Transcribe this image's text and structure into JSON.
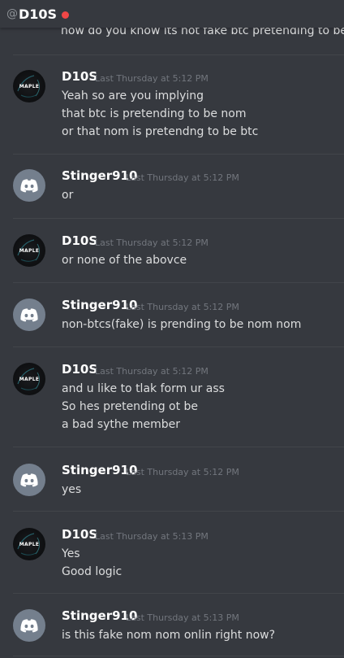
{
  "header": {
    "at_symbol": "@",
    "title": "D10S",
    "status_color": "#f04747"
  },
  "clipped_previous_line": "how do you know its not fake btc pretending to be nom n",
  "messages": [
    {
      "username": "D10S",
      "timestamp": "Last Thursday at 5:12 PM",
      "avatar": "maple",
      "lines": [
        "Yeah so are you implying",
        "that btc is pretending to be nom",
        "or that nom is pretendng to be btc"
      ]
    },
    {
      "username": "Stinger910",
      "timestamp": "Last Thursday at 5:12 PM",
      "avatar": "discord",
      "lines": [
        "or"
      ]
    },
    {
      "username": "D10S",
      "timestamp": "Last Thursday at 5:12 PM",
      "avatar": "maple",
      "lines": [
        "or none of the abovce"
      ]
    },
    {
      "username": "Stinger910",
      "timestamp": "Last Thursday at 5:12 PM",
      "avatar": "discord",
      "lines": [
        "non-btcs(fake) is prending to be nom nom"
      ]
    },
    {
      "username": "D10S",
      "timestamp": "Last Thursday at 5:12 PM",
      "avatar": "maple",
      "lines": [
        "and u like to tlak form ur ass",
        "So hes pretending ot be",
        "a bad sythe member"
      ]
    },
    {
      "username": "Stinger910",
      "timestamp": "Last Thursday at 5:12 PM",
      "avatar": "discord",
      "lines": [
        "yes"
      ]
    },
    {
      "username": "D10S",
      "timestamp": "Last Thursday at 5:13 PM",
      "avatar": "maple",
      "lines": [
        "Yes",
        "Good logic"
      ]
    },
    {
      "username": "Stinger910",
      "timestamp": "Last Thursday at 5:13 PM",
      "avatar": "discord",
      "lines": [
        "is this fake nom nom onlin right now?"
      ]
    }
  ],
  "avatars": {
    "maple_label": "MAPLE",
    "discord_color": "#747f8d"
  }
}
